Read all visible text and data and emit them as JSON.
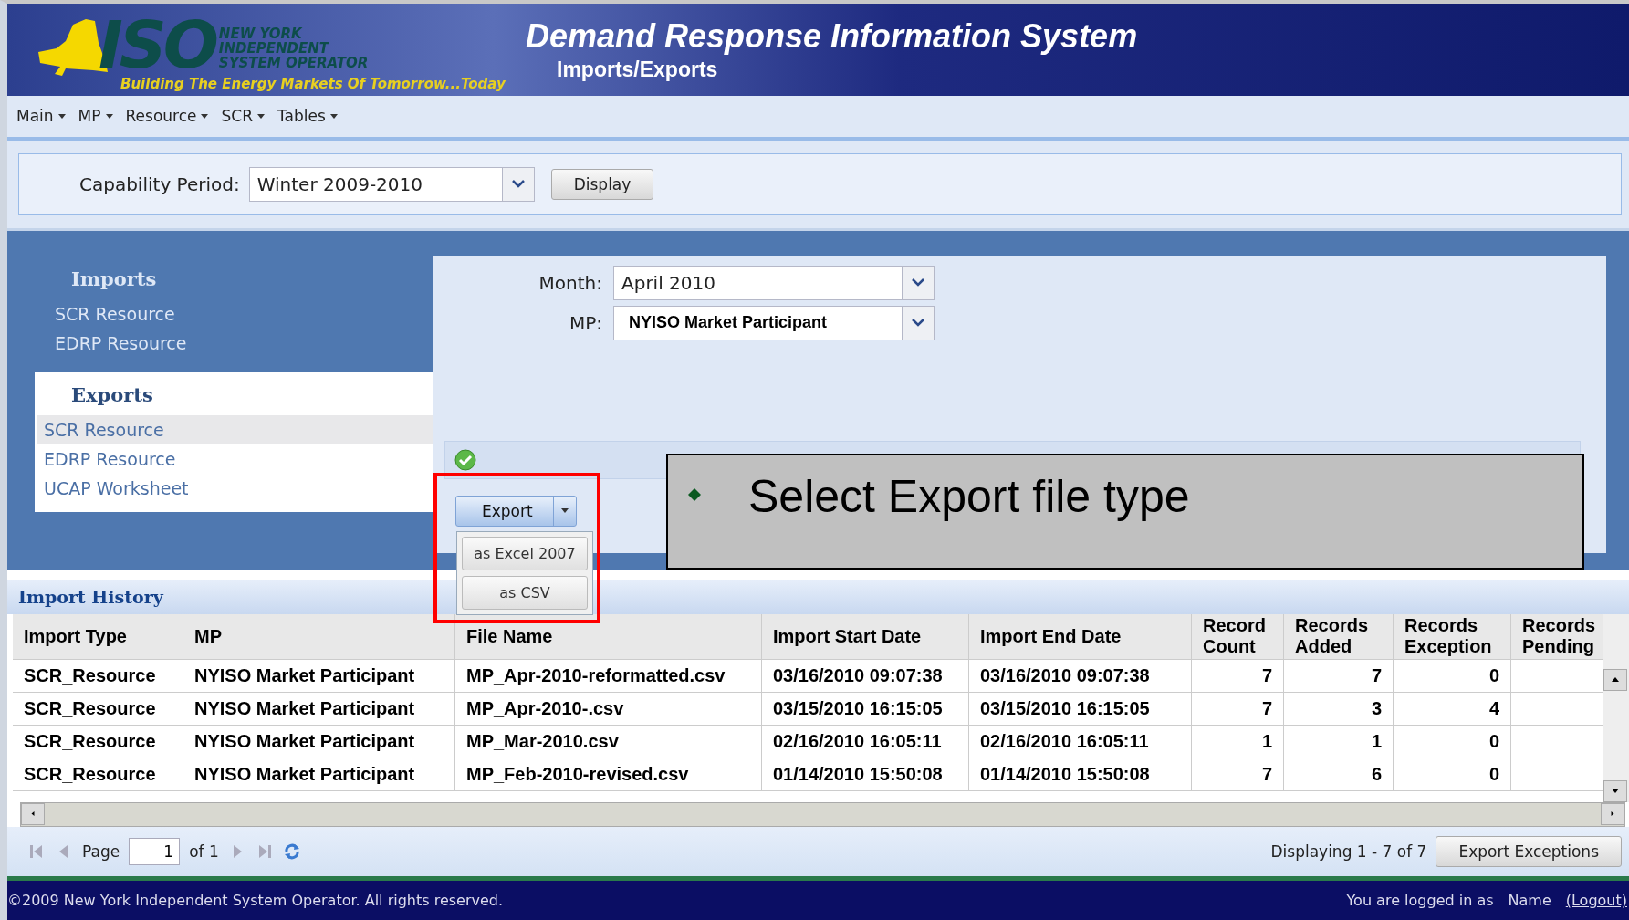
{
  "header": {
    "logo": {
      "letters": "ISO",
      "name_lines": [
        "NEW YORK",
        "INDEPENDENT",
        "SYSTEM OPERATOR"
      ],
      "tagline": "Building The Energy Markets Of Tomorrow...Today"
    },
    "title": "Demand Response Information System",
    "subtitle": "Imports/Exports"
  },
  "menu": [
    {
      "label": "Main"
    },
    {
      "label": "MP"
    },
    {
      "label": "Resource"
    },
    {
      "label": "SCR"
    },
    {
      "label": "Tables"
    }
  ],
  "capability_period": {
    "label": "Capability Period:",
    "value": "Winter 2009-2010",
    "button": "Display"
  },
  "sidebar": {
    "sections": [
      {
        "title": "Imports",
        "selected": false,
        "items": [
          {
            "label": "SCR Resource",
            "selected": false
          },
          {
            "label": "EDRP Resource",
            "selected": false
          }
        ]
      },
      {
        "title": "Exports",
        "selected": true,
        "items": [
          {
            "label": "SCR Resource",
            "selected": true
          },
          {
            "label": "EDRP Resource",
            "selected": false
          },
          {
            "label": "UCAP Worksheet",
            "selected": false
          }
        ]
      }
    ]
  },
  "form": {
    "fields": [
      {
        "label": "Month:",
        "value": "April 2010",
        "bold": false
      },
      {
        "label": "MP:",
        "value": "NYISO Market Participant",
        "bold": true
      }
    ]
  },
  "export": {
    "button": "Export",
    "menu": [
      {
        "label": "as Excel 2007"
      },
      {
        "label": "as CSV"
      }
    ]
  },
  "callout": {
    "text": "Select Export file type"
  },
  "import_history": {
    "title": "Import History",
    "columns": [
      "Import Type",
      "MP",
      "File Name",
      "Import Start Date",
      "Import End Date",
      "Record Count",
      "Records Added",
      "Records Exception",
      "Records Pending"
    ],
    "rows": [
      [
        "SCR_Resource",
        "NYISO Market Participant",
        "MP_Apr-2010-reformatted.csv",
        "03/16/2010 09:07:38",
        "03/16/2010 09:07:38",
        "7",
        "7",
        "0",
        ""
      ],
      [
        "SCR_Resource",
        "NYISO Market Participant",
        "MP_Apr-2010-.csv",
        "03/15/2010 16:15:05",
        "03/15/2010 16:15:05",
        "7",
        "3",
        "4",
        ""
      ],
      [
        "SCR_Resource",
        "NYISO Market Participant",
        "MP_Mar-2010.csv",
        "02/16/2010 16:05:11",
        "02/16/2010 16:05:11",
        "1",
        "1",
        "0",
        ""
      ],
      [
        "SCR_Resource",
        "NYISO Market Participant",
        "MP_Feb-2010-revised.csv",
        "01/14/2010 15:50:08",
        "01/14/2010 15:50:08",
        "7",
        "6",
        "0",
        ""
      ]
    ]
  },
  "pager": {
    "page_label": "Page",
    "page": "1",
    "of": "of 1",
    "display": "Displaying 1 - 7 of 7",
    "button": "Export Exceptions"
  },
  "footer": {
    "copyright": "©2009   New York Independent System Operator. All rights reserved.",
    "logged_in": "You are logged in as",
    "user": "Name",
    "logout": "(Logout)"
  }
}
